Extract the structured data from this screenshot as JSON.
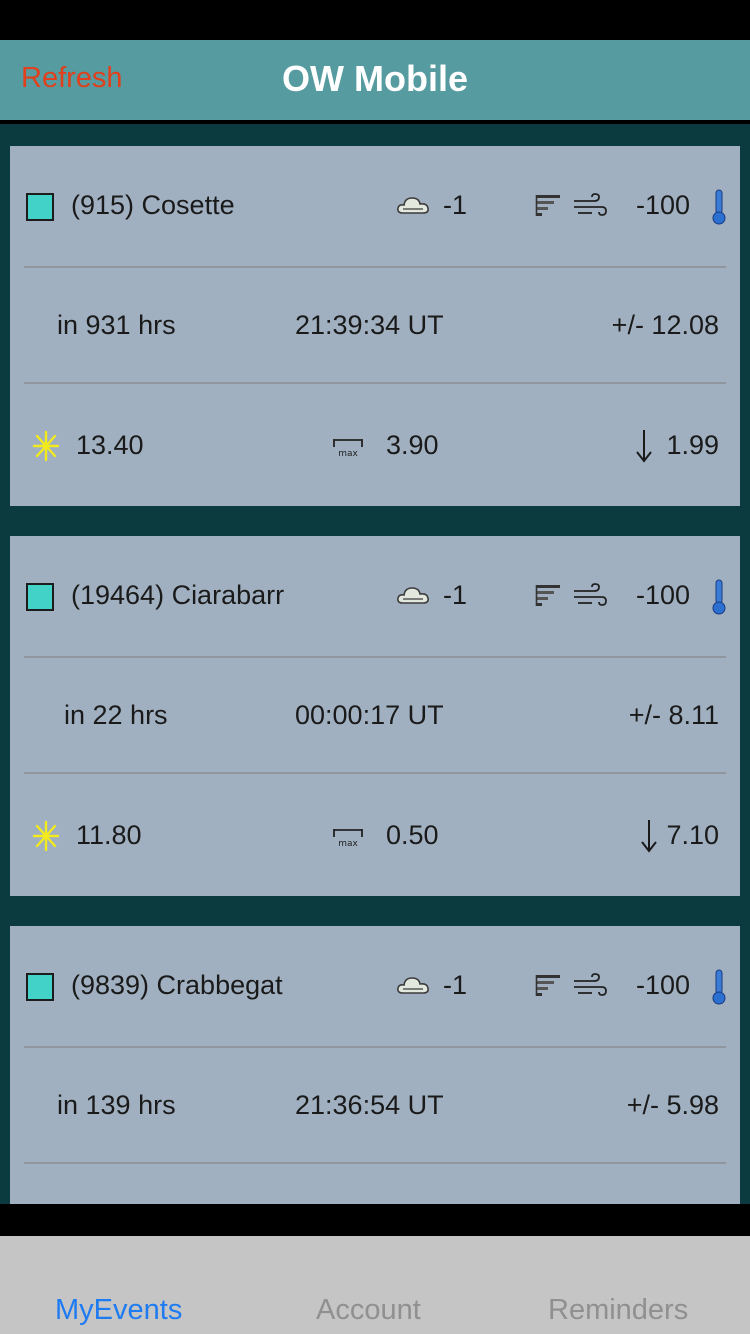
{
  "app": {
    "title": "OW Mobile",
    "refresh_label": "Refresh"
  },
  "events": [
    {
      "name": "(915) Cosette",
      "cloud": "-1",
      "temp": "-100",
      "in_hours": "in 931 hrs",
      "time": "21:39:34 UT",
      "tolerance": "+/- 12.08",
      "star": "13.40",
      "max": "3.90",
      "drop": "1.99"
    },
    {
      "name": "(19464) Ciarabarr",
      "cloud": "-1",
      "temp": "-100",
      "in_hours": "in 22 hrs",
      "time": "00:00:17 UT",
      "tolerance": "+/- 8.11",
      "star": "11.80",
      "max": "0.50",
      "drop": "7.10"
    },
    {
      "name": "(9839) Crabbegat",
      "cloud": "-1",
      "temp": "-100",
      "in_hours": "in 139 hrs",
      "time": "21:36:54 UT",
      "tolerance": "+/- 5.98",
      "star": "",
      "max": "",
      "drop": ""
    }
  ],
  "tabs": [
    {
      "label": "MyEvents",
      "active": true
    },
    {
      "label": "Account",
      "active": false
    },
    {
      "label": "Reminders",
      "active": false
    }
  ],
  "icons": {
    "checkbox": "checkbox-icon",
    "cloud": "cloud-icon",
    "cloud_bars": "signal-bars-icon",
    "wind": "wind-icon",
    "temperature": "thermometer-icon",
    "star": "star-brightness-icon",
    "max": "max-duration-icon",
    "drop": "magnitude-drop-icon"
  },
  "colors": {
    "navbar": "#559b9f",
    "refresh": "#e0401c",
    "background": "#0b3b3f",
    "card": "#a0b0c0",
    "checkbox": "#42d2c8",
    "tab_active": "#1e7bf2",
    "tab_inactive": "#909090"
  }
}
